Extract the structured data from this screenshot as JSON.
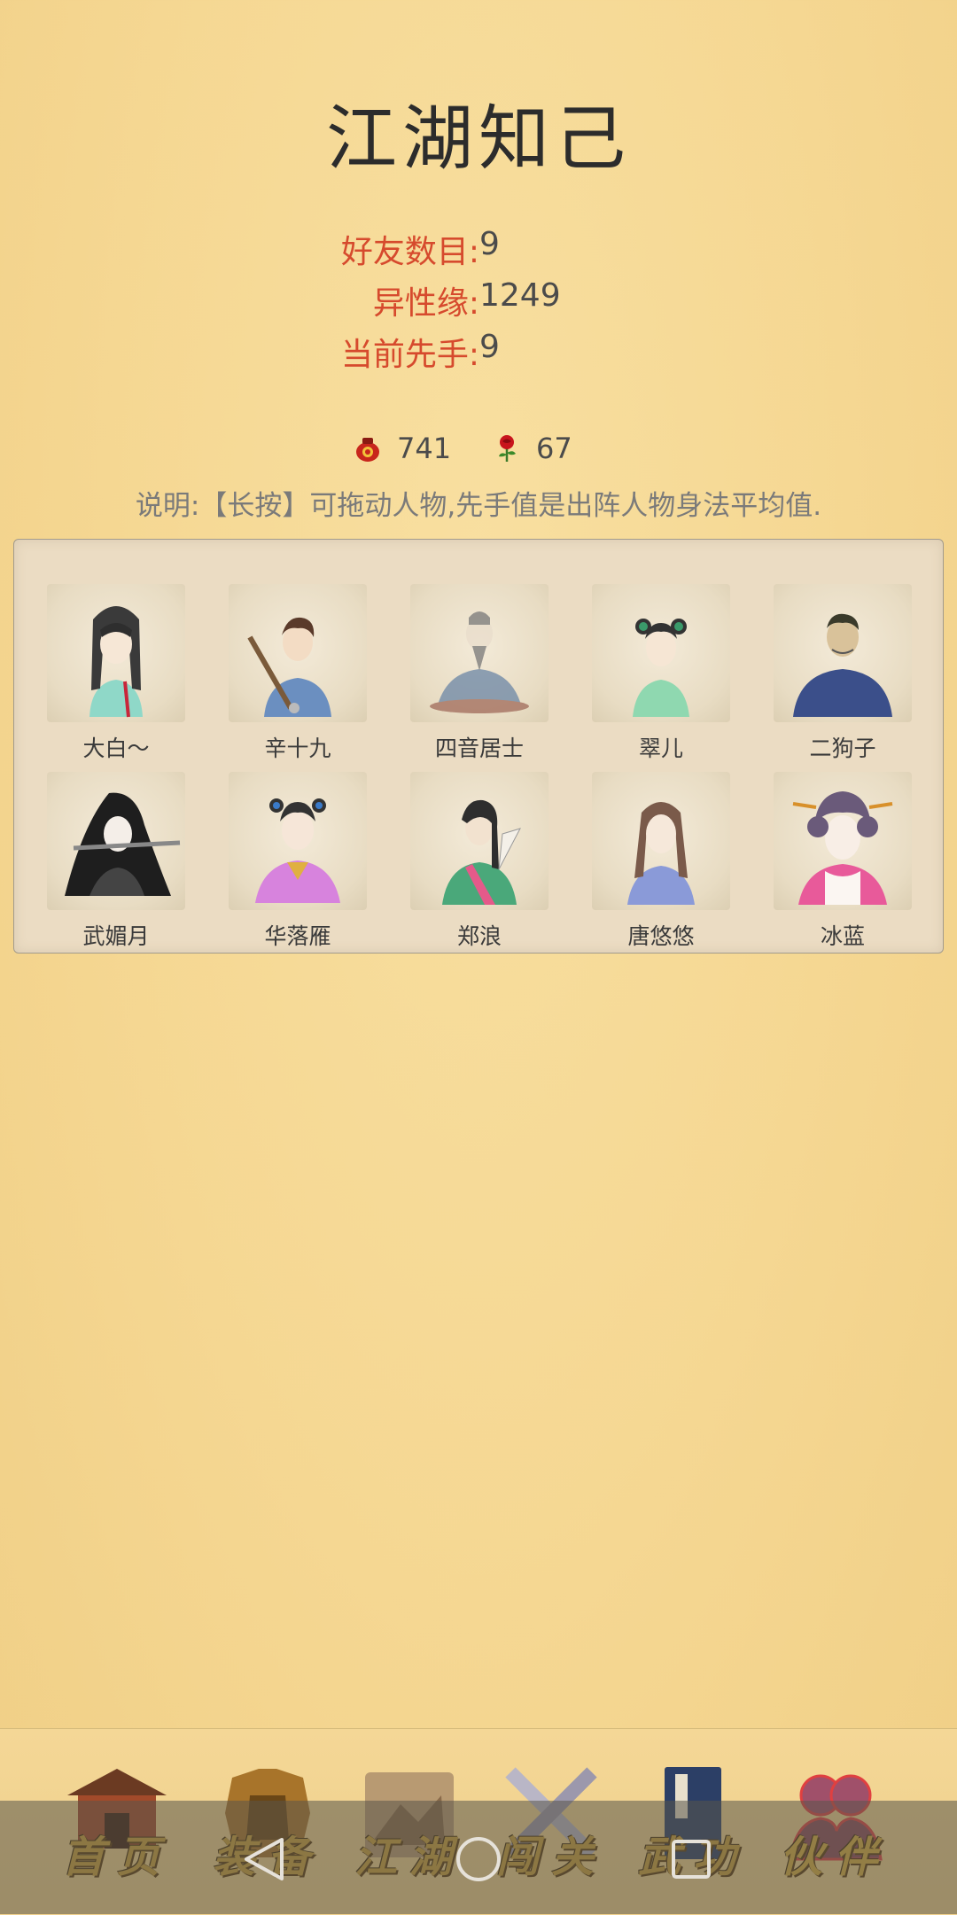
{
  "page": {
    "title": "江湖知己"
  },
  "stats": [
    {
      "label": "好友数目:",
      "value": "9"
    },
    {
      "label": "异性缘:",
      "value": "1249"
    },
    {
      "label": "当前先手:",
      "value": "9"
    }
  ],
  "resources": [
    {
      "icon": "wine-jar-icon",
      "value": "741"
    },
    {
      "icon": "rose-icon",
      "value": "67"
    }
  ],
  "note": "说明:【长按】可拖动人物,先手值是出阵人物身法平均值.",
  "friends": [
    {
      "name": "大白～"
    },
    {
      "name": "辛十九"
    },
    {
      "name": "四音居士"
    },
    {
      "name": "翠儿"
    },
    {
      "name": "二狗子"
    },
    {
      "name": "武媚月"
    },
    {
      "name": "华落雁"
    },
    {
      "name": "郑浪"
    },
    {
      "name": "唐悠悠"
    },
    {
      "name": "冰蓝"
    }
  ],
  "nav": [
    {
      "label": "首页",
      "icon": "temple-icon"
    },
    {
      "label": "装备",
      "icon": "armor-icon"
    },
    {
      "label": "江湖",
      "icon": "map-scroll-icon"
    },
    {
      "label": "闯关",
      "icon": "crossed-swords-icon"
    },
    {
      "label": "武功",
      "icon": "book-icon"
    },
    {
      "label": "伙伴",
      "icon": "partners-icon",
      "active": true
    }
  ],
  "system_nav": [
    {
      "icon": "back-triangle-icon"
    },
    {
      "icon": "home-circle-icon"
    },
    {
      "icon": "recents-square-icon"
    }
  ]
}
